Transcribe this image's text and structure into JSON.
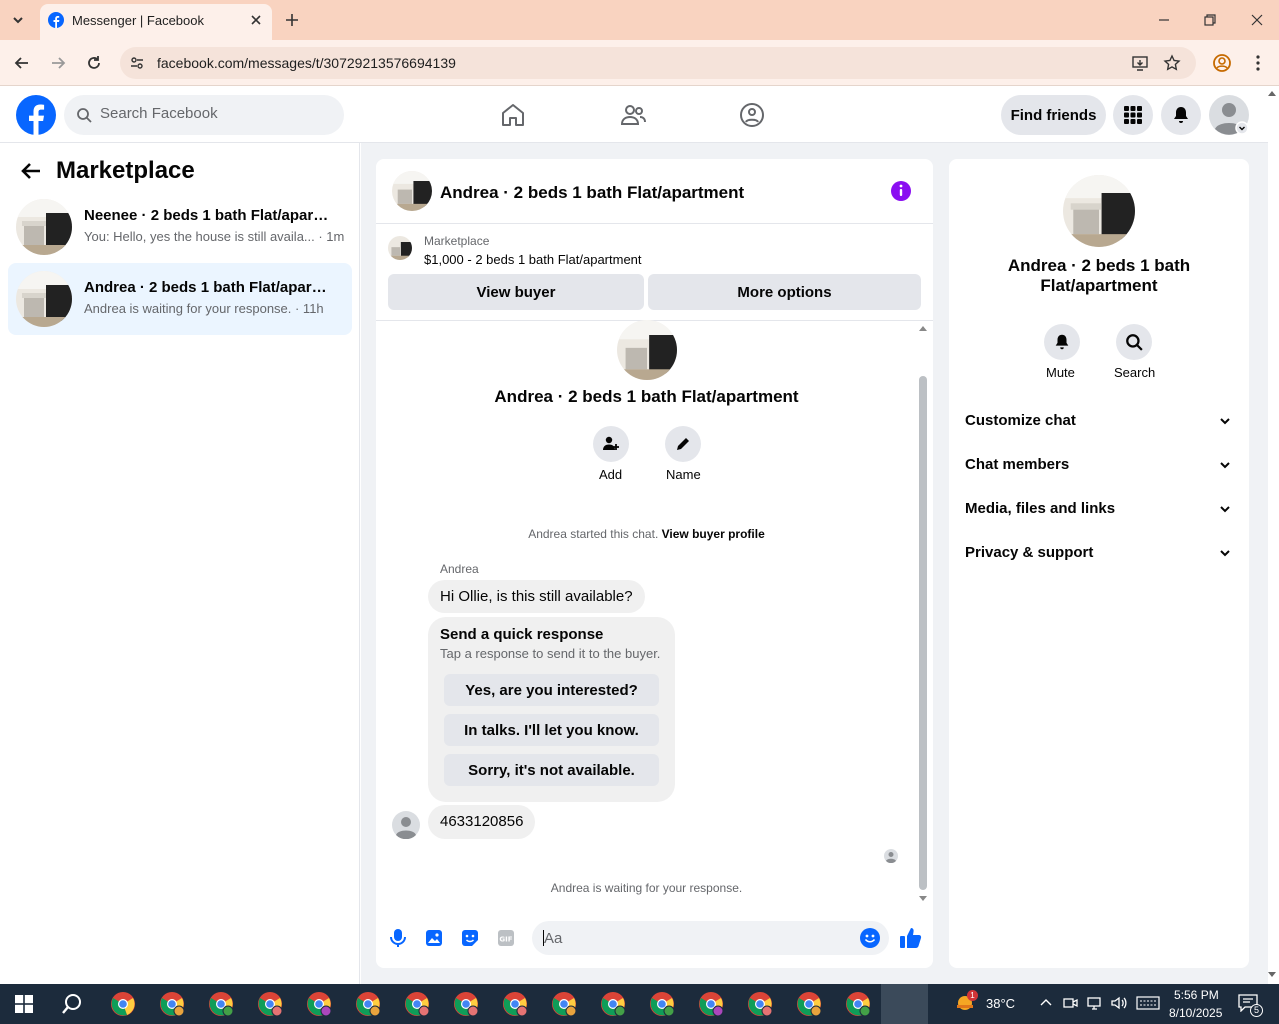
{
  "browser": {
    "tab_title": "Messenger | Facebook",
    "url": "facebook.com/messages/t/30729213576694139"
  },
  "fb": {
    "search_placeholder": "Search Facebook",
    "find_friends": "Find friends"
  },
  "sidebar": {
    "title": "Marketplace",
    "conversations": [
      {
        "title": "Neenee · 2 beds 1 bath Flat/apart...",
        "subtitle": "You: Hello, yes the house is still availa... · 1m"
      },
      {
        "title": "Andrea · 2 beds 1 bath Flat/apartm...",
        "subtitle": "Andrea is waiting for your response. · 11h"
      }
    ]
  },
  "chat": {
    "header_title": "Andrea · 2 beds 1 bath Flat/apartment",
    "listing_source": "Marketplace",
    "listing_title": "$1,000 - 2 beds 1 bath Flat/apartment",
    "view_buyer": "View buyer",
    "more_options": "More options",
    "profile_name": "Andrea · 2 beds 1 bath Flat/apartment",
    "add_label": "Add",
    "name_label": "Name",
    "started_text": "Andrea started this chat.",
    "view_buyer_profile": "View buyer profile",
    "sender_name": "Andrea",
    "message1": "Hi Ollie, is this still available?",
    "quick_title": "Send a quick response",
    "quick_sub": "Tap a response to send it to the buyer.",
    "quick_replies": [
      "Yes, are you interested?",
      "In talks. I'll let you know.",
      "Sorry, it's not available."
    ],
    "message2": "4633120856",
    "waiting_text": "Andrea is waiting for your response.",
    "composer_placeholder": "Aa"
  },
  "info": {
    "title": "Andrea · 2 beds 1 bath Flat/apartment",
    "mute": "Mute",
    "search": "Search",
    "sections": [
      "Customize chat",
      "Chat members",
      "Media, files and links",
      "Privacy & support"
    ]
  },
  "taskbar": {
    "temperature": "38°C",
    "time": "5:56 PM",
    "date": "8/10/2025",
    "weather_badge": "1",
    "notif_count": "5"
  },
  "colors": {
    "fb_blue": "#0866ff",
    "accent_purple": "#8a0ef1",
    "tab_bg": "#f9d3c0"
  }
}
